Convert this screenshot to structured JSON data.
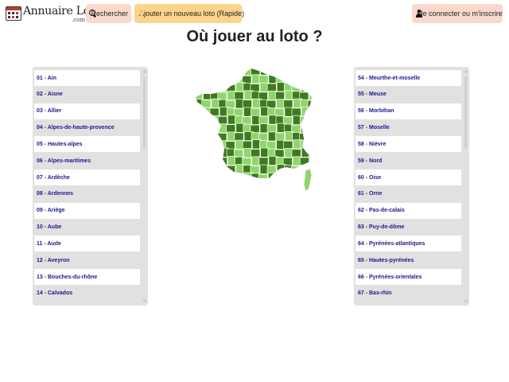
{
  "header": {
    "logo_text": "Annuaire Loto",
    "logo_sub": ".com",
    "search_label": "Rechercher",
    "add_label": "Ajouter un nouveau loto (Rapide)",
    "login_label": "Me connecter ou m'inscrire"
  },
  "page_title": "Où jouer au loto ?",
  "colors": {
    "button_salmon": "#f9d9cc",
    "button_orange": "#fcd48b",
    "link_blue": "#1a1a8c",
    "map_dark_green": "#3f7a1f",
    "map_light_green": "#8fd66a"
  },
  "left_list": [
    "01 - Ain",
    "02 - Aisne",
    "03 - Allier",
    "04 - Alpes-de-haute-provence",
    "05 - Hautes-alpes",
    "06 - Alpes-maritimes",
    "07 - Ardèche",
    "08 - Ardennes",
    "09 - Ariège",
    "10 - Aube",
    "11 - Aude",
    "12 - Aveyron",
    "13 - Bouches-du-rhône",
    "14 - Calvados"
  ],
  "right_list": [
    "54 - Meurthe-et-moselle",
    "55 - Meuse",
    "56 - Morbihan",
    "57 - Moselle",
    "58 - Nièvre",
    "59 - Nord",
    "60 - Oise",
    "61 - Orne",
    "62 - Pas-de-calais",
    "63 - Puy-de-dôme",
    "64 - Pyrénées-atlantiques",
    "65 - Hautes-pyrénées",
    "66 - Pyrénées-orientales",
    "67 - Bas-rhin"
  ]
}
